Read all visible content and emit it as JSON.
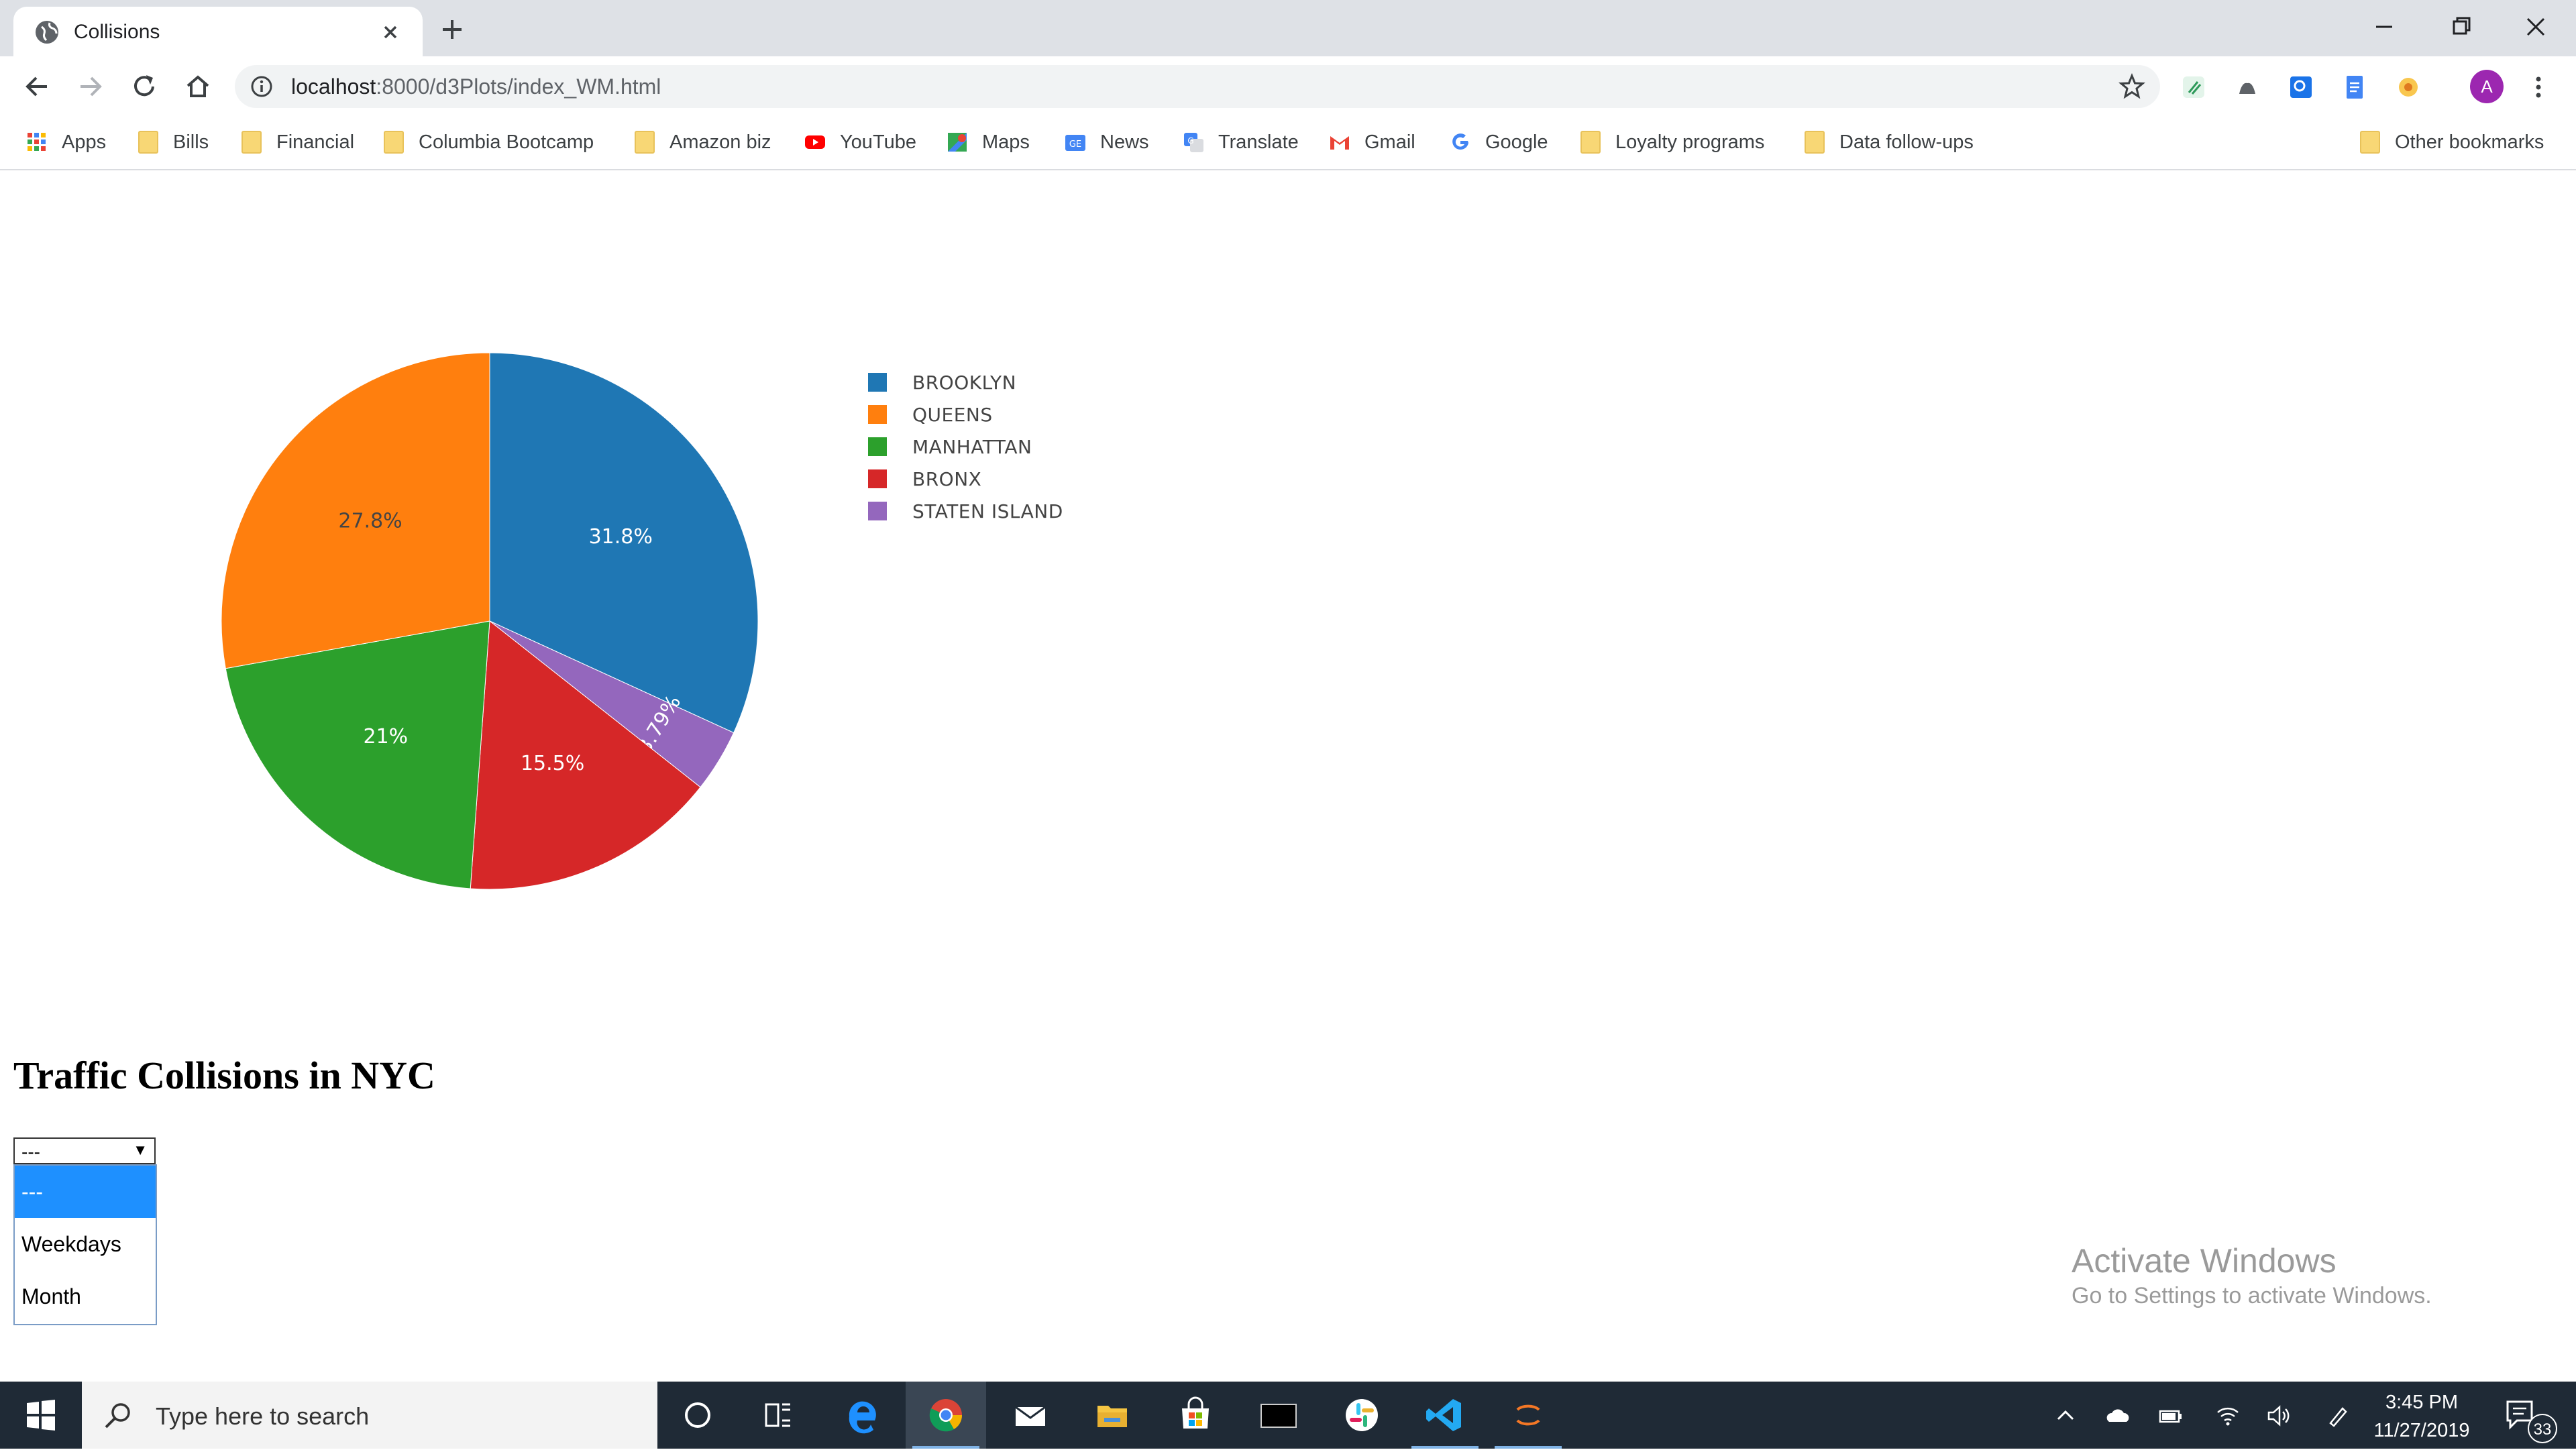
{
  "browser": {
    "tab_title": "Collisions",
    "url_host": "localhost",
    "url_path": ":8000/d3Plots/index_WM.html",
    "avatar_letter": "A",
    "bookmarks": [
      {
        "label": "Apps",
        "icon": "apps-grid-icon"
      },
      {
        "label": "Bills",
        "icon": "folder-icon"
      },
      {
        "label": "Financial",
        "icon": "folder-icon"
      },
      {
        "label": "Columbia Bootcamp",
        "icon": "folder-icon"
      },
      {
        "label": "Amazon biz",
        "icon": "folder-icon"
      },
      {
        "label": "YouTube",
        "icon": "youtube-icon"
      },
      {
        "label": "Maps",
        "icon": "maps-icon"
      },
      {
        "label": "News",
        "icon": "news-icon"
      },
      {
        "label": "Translate",
        "icon": "translate-icon"
      },
      {
        "label": "Gmail",
        "icon": "gmail-icon"
      },
      {
        "label": "Google",
        "icon": "google-icon"
      },
      {
        "label": "Loyalty programs",
        "icon": "folder-icon"
      },
      {
        "label": "Data follow-ups",
        "icon": "folder-icon"
      }
    ],
    "other_bookmarks": "Other bookmarks"
  },
  "chart_data": {
    "type": "pie",
    "categories": [
      "BROOKLYN",
      "QUEENS",
      "MANHATTAN",
      "BRONX",
      "STATEN ISLAND"
    ],
    "values": [
      31.8,
      27.8,
      21,
      15.5,
      3.79
    ],
    "labels": [
      "31.8%",
      "27.8%",
      "21%",
      "15.5%",
      "3.79%"
    ],
    "colors": [
      "#1f77b4",
      "#ff7f0e",
      "#2ca02c",
      "#d62728",
      "#9467bd"
    ],
    "legend_placement": "right"
  },
  "page": {
    "title": "Traffic Collisions in NYC",
    "select": {
      "value": "---",
      "options": [
        "---",
        "Weekdays",
        "Month"
      ],
      "selected_index": 0
    }
  },
  "watermark": {
    "title": "Activate Windows",
    "subtitle": "Go to Settings to activate Windows."
  },
  "taskbar": {
    "search_placeholder": "Type here to search",
    "time": "3:45 PM",
    "date": "11/27/2019",
    "notification_count": "33"
  }
}
